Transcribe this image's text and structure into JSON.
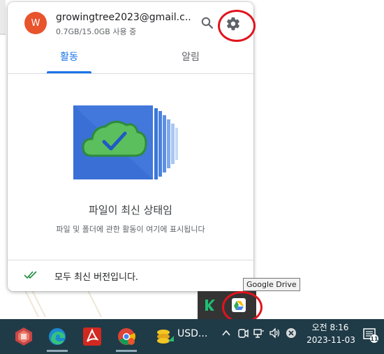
{
  "account": {
    "avatar_initial": "W",
    "email": "growingtree2023@gmail.c...",
    "quota": "0.7GB/15.0GB 사용 중"
  },
  "tabs": [
    {
      "label": "활동",
      "active": true
    },
    {
      "label": "알림",
      "active": false
    }
  ],
  "empty_state": {
    "title": "파일이 최신 상태임",
    "subtitle": "파일 및 폴더에 관한 활동이 여기에 표시됩니다"
  },
  "footer": {
    "status": "모두 최신 버전입니다."
  },
  "tooltip": {
    "text": "Google Drive"
  },
  "taskbar": {
    "pinned": [
      "app-icon",
      "edge-icon",
      "acrobat-icon",
      "chrome-icon",
      "stock-icon"
    ],
    "stock_label": "USD...",
    "clock_time": "오전 8:16",
    "clock_date": "2023-11-03",
    "notification_count": "11"
  },
  "colors": {
    "accent": "#1a73e8",
    "avatar": "#e8542c",
    "taskbar": "#1f3b47",
    "highlight": "#e0141e"
  }
}
